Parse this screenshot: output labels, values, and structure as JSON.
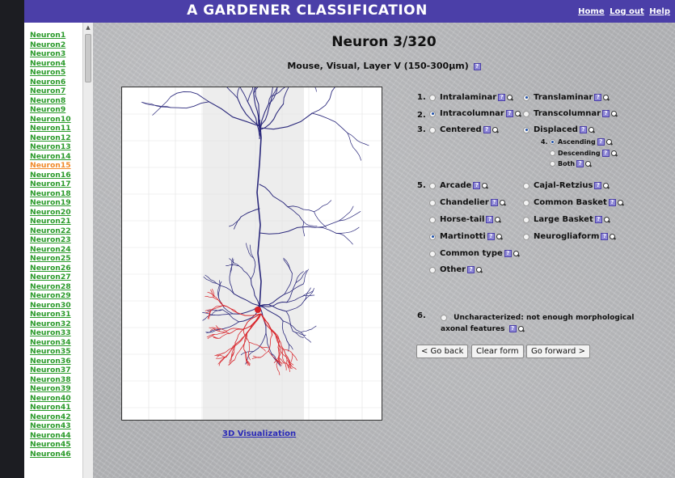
{
  "app": {
    "title": "A GARDENER CLASSIFICATION",
    "links": [
      "Home",
      "Log out",
      "Help"
    ]
  },
  "sidebar": {
    "neurons": [
      "Neuron1",
      "Neuron2",
      "Neuron3",
      "Neuron4",
      "Neuron5",
      "Neuron6",
      "Neuron7",
      "Neuron8",
      "Neuron9",
      "Neuron10",
      "Neuron11",
      "Neuron12",
      "Neuron13",
      "Neuron14",
      "Neuron15",
      "Neuron16",
      "Neuron17",
      "Neuron18",
      "Neuron19",
      "Neuron20",
      "Neuron21",
      "Neuron22",
      "Neuron23",
      "Neuron24",
      "Neuron25",
      "Neuron26",
      "Neuron27",
      "Neuron28",
      "Neuron29",
      "Neuron30",
      "Neuron31",
      "Neuron32",
      "Neuron33",
      "Neuron34",
      "Neuron35",
      "Neuron36",
      "Neuron37",
      "Neuron38",
      "Neuron39",
      "Neuron40",
      "Neuron41",
      "Neuron42",
      "Neuron43",
      "Neuron44",
      "Neuron45",
      "Neuron46"
    ],
    "active": "Neuron15"
  },
  "main": {
    "title": "Neuron 3/320",
    "subtitle": "Mouse, Visual, Layer V (150-300µm)",
    "viz_link": "3D Visualization"
  },
  "questions": {
    "q1": {
      "num": "1.",
      "options": [
        {
          "label": "Intralaminar",
          "checked": false
        },
        {
          "label": "Translaminar",
          "checked": true
        }
      ]
    },
    "q2": {
      "num": "2.",
      "options": [
        {
          "label": "Intracolumnar",
          "checked": true
        },
        {
          "label": "Transcolumnar",
          "checked": false
        }
      ]
    },
    "q3": {
      "num": "3.",
      "options": [
        {
          "label": "Centered",
          "checked": false
        },
        {
          "label": "Displaced",
          "checked": true
        }
      ]
    },
    "q4": {
      "num": "4.",
      "options": [
        {
          "label": "Ascending",
          "checked": true
        },
        {
          "label": "Descending",
          "checked": false
        },
        {
          "label": "Both",
          "checked": false
        }
      ]
    },
    "q5": {
      "num": "5.",
      "options": [
        {
          "label": "Arcade",
          "checked": false
        },
        {
          "label": "Cajal-Retzius",
          "checked": false
        },
        {
          "label": "Chandelier",
          "checked": false
        },
        {
          "label": "Common Basket",
          "checked": false
        },
        {
          "label": "Horse-tail",
          "checked": false
        },
        {
          "label": "Large Basket",
          "checked": false
        },
        {
          "label": "Martinotti",
          "checked": true
        },
        {
          "label": "Neurogliaform",
          "checked": false
        },
        {
          "label": "Common type",
          "checked": false
        },
        {
          "label": "Other",
          "checked": false
        }
      ]
    },
    "q6": {
      "num": "6.",
      "label": "Uncharacterized:",
      "note": "not enough morphological axonal features",
      "checked": false
    }
  },
  "buttons": {
    "back": "< Go back",
    "clear": "Clear form",
    "forward": "Go forward >"
  },
  "colors": {
    "topbar": "#4b3fa8",
    "dendrite": "#2c2a7c",
    "axon": "#d8242a",
    "link_green": "#2a9a2a",
    "link_active": "#f08a2a"
  }
}
